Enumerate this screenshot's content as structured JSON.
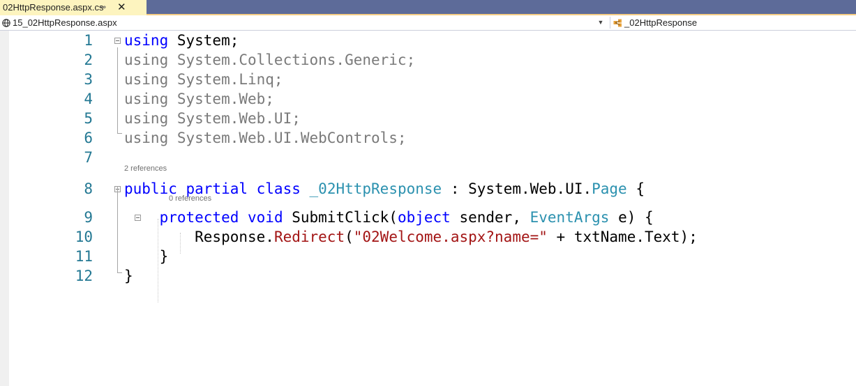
{
  "tab": {
    "title": "02HttpResponse.aspx.cs",
    "pin_icon": "pin-icon",
    "close_icon": "close-icon"
  },
  "navbar": {
    "file": "15_02HttpResponse.aspx",
    "class": "_02HttpResponse",
    "globe_icon": "globe-icon",
    "class_icon": "class-icon"
  },
  "editor": {
    "lines": [
      {
        "num": "1",
        "tokens": [
          {
            "t": "using",
            "c": "kw"
          },
          {
            "t": " System;",
            "c": ""
          }
        ]
      },
      {
        "num": "2",
        "tokens": [
          {
            "t": "using System.Collections.Generic;",
            "c": "grey"
          }
        ]
      },
      {
        "num": "3",
        "tokens": [
          {
            "t": "using System.Linq;",
            "c": "grey"
          }
        ]
      },
      {
        "num": "4",
        "tokens": [
          {
            "t": "using System.Web;",
            "c": "grey"
          }
        ]
      },
      {
        "num": "5",
        "tokens": [
          {
            "t": "using System.Web.UI;",
            "c": "grey"
          }
        ]
      },
      {
        "num": "6",
        "tokens": [
          {
            "t": "using System.Web.UI.WebControls;",
            "c": "grey"
          }
        ]
      },
      {
        "num": "7",
        "tokens": []
      },
      {
        "num": "8",
        "tokens": [
          {
            "t": "public partial class",
            "c": "kw"
          },
          {
            "t": " ",
            "c": ""
          },
          {
            "t": "_02HttpResponse",
            "c": "cls"
          },
          {
            "t": " : System.Web.UI.",
            "c": ""
          },
          {
            "t": "Page",
            "c": "typ"
          },
          {
            "t": " {",
            "c": ""
          }
        ]
      },
      {
        "num": "9",
        "tokens": [
          {
            "t": "    ",
            "c": ""
          },
          {
            "t": "protected void",
            "c": "kw"
          },
          {
            "t": " SubmitClick(",
            "c": ""
          },
          {
            "t": "object",
            "c": "kw"
          },
          {
            "t": " sender, ",
            "c": ""
          },
          {
            "t": "EventArgs",
            "c": "typ"
          },
          {
            "t": " e) {",
            "c": ""
          }
        ]
      },
      {
        "num": "10",
        "tokens": [
          {
            "t": "        Response.",
            "c": ""
          },
          {
            "t": "Redirect",
            "c": "str"
          },
          {
            "t": "(",
            "c": ""
          },
          {
            "t": "\"02Welcome.aspx?name=\"",
            "c": "str"
          },
          {
            "t": " + txtName.Text);",
            "c": ""
          }
        ]
      },
      {
        "num": "11",
        "tokens": [
          {
            "t": "    }",
            "c": ""
          }
        ]
      },
      {
        "num": "12",
        "tokens": [
          {
            "t": "}",
            "c": ""
          }
        ]
      }
    ],
    "codelens": [
      {
        "before_line": "8",
        "text": "2 references"
      },
      {
        "before_line": "9",
        "text": "0 references"
      }
    ]
  }
}
